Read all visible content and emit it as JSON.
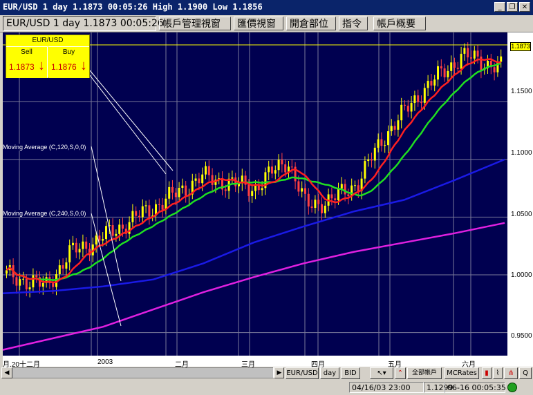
{
  "window": {
    "title": "EUR/USD 1 day 1.1873 00:05:26 High 1.1900 Low 1.1856",
    "buttons": [
      "_",
      "❐",
      "✕"
    ]
  },
  "tabs": [
    {
      "label": "EUR/USD 1 day 1.1873 00:05:26",
      "active": true
    },
    {
      "label": "帳戶管理視窗",
      "active": false
    },
    {
      "label": "匯價視窗",
      "active": false
    },
    {
      "label": "開倉部位",
      "active": false
    },
    {
      "label": "指令",
      "active": false
    },
    {
      "label": "帳戶概要",
      "active": false
    }
  ],
  "quote_panel": {
    "symbol": "EUR/USD",
    "sell_label": "Sell",
    "sell_value": "1.1873",
    "buy_label": "Buy",
    "buy_value": "1.1876",
    "arrow": "↓"
  },
  "indicators": {
    "ma120": "Moving Average (C,120,S,0,0)",
    "ma240": "Moving Average (C,240,S,0,0)"
  },
  "current_price": "1.1873",
  "chart_data": {
    "type": "line",
    "title": "EUR/USD 1 day",
    "y_ticks": [
      "1.1500",
      "1.1000",
      "1.0500",
      "1.0000",
      "0.9500"
    ],
    "x_ticks": [
      "月.20",
      "十二月",
      "2003",
      "二月",
      "三月",
      "四月",
      "五月",
      "六月"
    ],
    "ylim": [
      0.93,
      1.21
    ],
    "grid": true,
    "series": [
      {
        "name": "Moving Average (C,120,S,0,0)",
        "color": "#1a1ae6",
        "values": [
          0.984,
          0.986,
          0.99,
          0.996,
          1.01,
          1.028,
          1.042,
          1.055,
          1.065,
          1.082,
          1.1
        ]
      },
      {
        "name": "Moving Average (C,240,S,0,0)",
        "color": "#e020e0",
        "values": [
          0.935,
          0.945,
          0.955,
          0.97,
          0.985,
          0.998,
          1.01,
          1.02,
          1.028,
          1.036,
          1.045
        ]
      }
    ],
    "colors": {
      "background": "#000050",
      "grid": "#7a7a9a",
      "up_candle": "#ffff00",
      "down_candle": "#ff4040",
      "ma_fast": "#ff2020",
      "ma_slow": "#20e020"
    }
  },
  "toolbar": {
    "symbol_button": "EUR/USD",
    "period_button": "day",
    "side_button": "BID",
    "account_button": "全部帳戶",
    "mcrates_button": "MCRates",
    "q_button": "Q"
  },
  "status": {
    "datetime": "04/16/03 23:00",
    "price": "1.1299",
    "last_update": "06-16 00:05:35"
  }
}
